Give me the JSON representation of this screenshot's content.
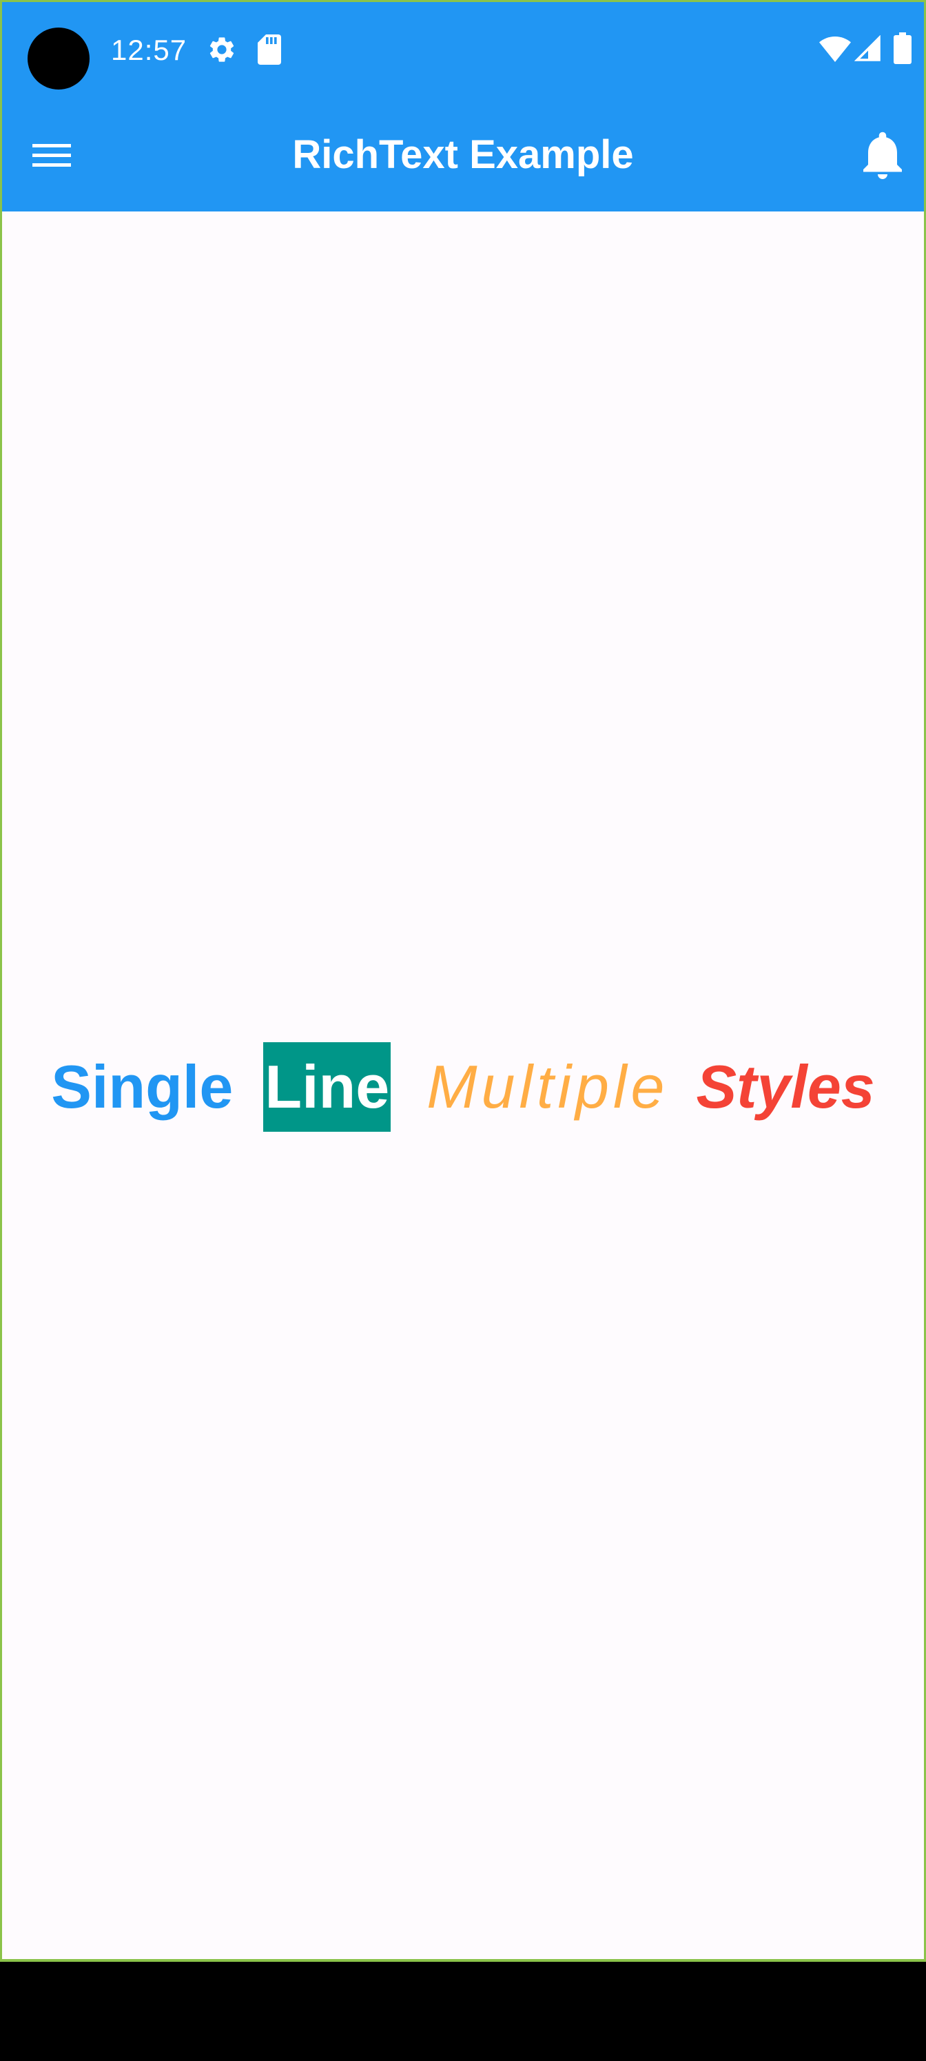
{
  "status_bar": {
    "time": "12:57",
    "icons": [
      "settings-icon",
      "sd-card-icon",
      "wifi-icon",
      "cellular-signal-icon",
      "battery-icon"
    ],
    "background": "#2196f3"
  },
  "app_bar": {
    "title": "RichText Example",
    "leading_icon": "menu-icon",
    "trailing_icon": "notifications-bell-icon",
    "background": "#2196f3",
    "foreground": "#ffffff"
  },
  "rich_text": {
    "spans": [
      {
        "text": "Single",
        "color": "#2196f3",
        "style": "bold"
      },
      {
        "text": "Line",
        "color": "#ffffff",
        "background": "#009688",
        "style": "bold"
      },
      {
        "text": "Multiple",
        "color": "#ffad45",
        "style": "italic"
      },
      {
        "text": "Styles",
        "color": "#f44336",
        "style": "bold-italic"
      }
    ]
  },
  "colors": {
    "page_background": "#fefbfe",
    "frame_border": "#8bc34a",
    "navigation_bar": "#000000"
  }
}
